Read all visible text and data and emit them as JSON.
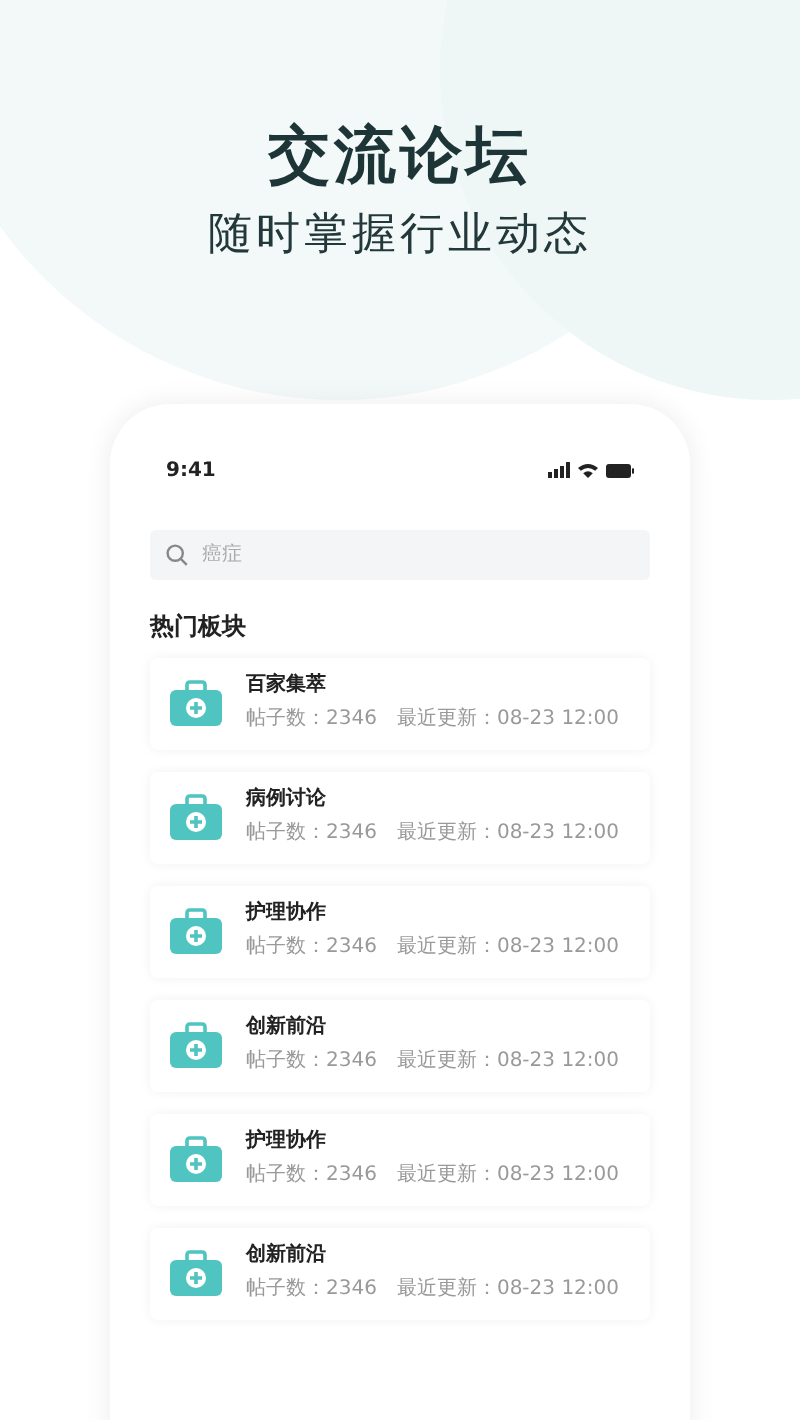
{
  "header": {
    "title": "交流论坛",
    "subtitle": "随时掌握行业动态"
  },
  "status_bar": {
    "time": "9:41"
  },
  "search": {
    "placeholder": "癌症"
  },
  "section_title": "热门板块",
  "forums": [
    {
      "name": "百家集萃",
      "posts": "帖子数：2346",
      "updated": "最近更新：08-23 12:00"
    },
    {
      "name": "病例讨论",
      "posts": "帖子数：2346",
      "updated": "最近更新：08-23 12:00"
    },
    {
      "name": "护理协作",
      "posts": "帖子数：2346",
      "updated": "最近更新：08-23 12:00"
    },
    {
      "name": "创新前沿",
      "posts": "帖子数：2346",
      "updated": "最近更新：08-23 12:00"
    },
    {
      "name": "护理协作",
      "posts": "帖子数：2346",
      "updated": "最近更新：08-23 12:00"
    },
    {
      "name": "创新前沿",
      "posts": "帖子数：2346",
      "updated": "最近更新：08-23 12:00"
    }
  ]
}
